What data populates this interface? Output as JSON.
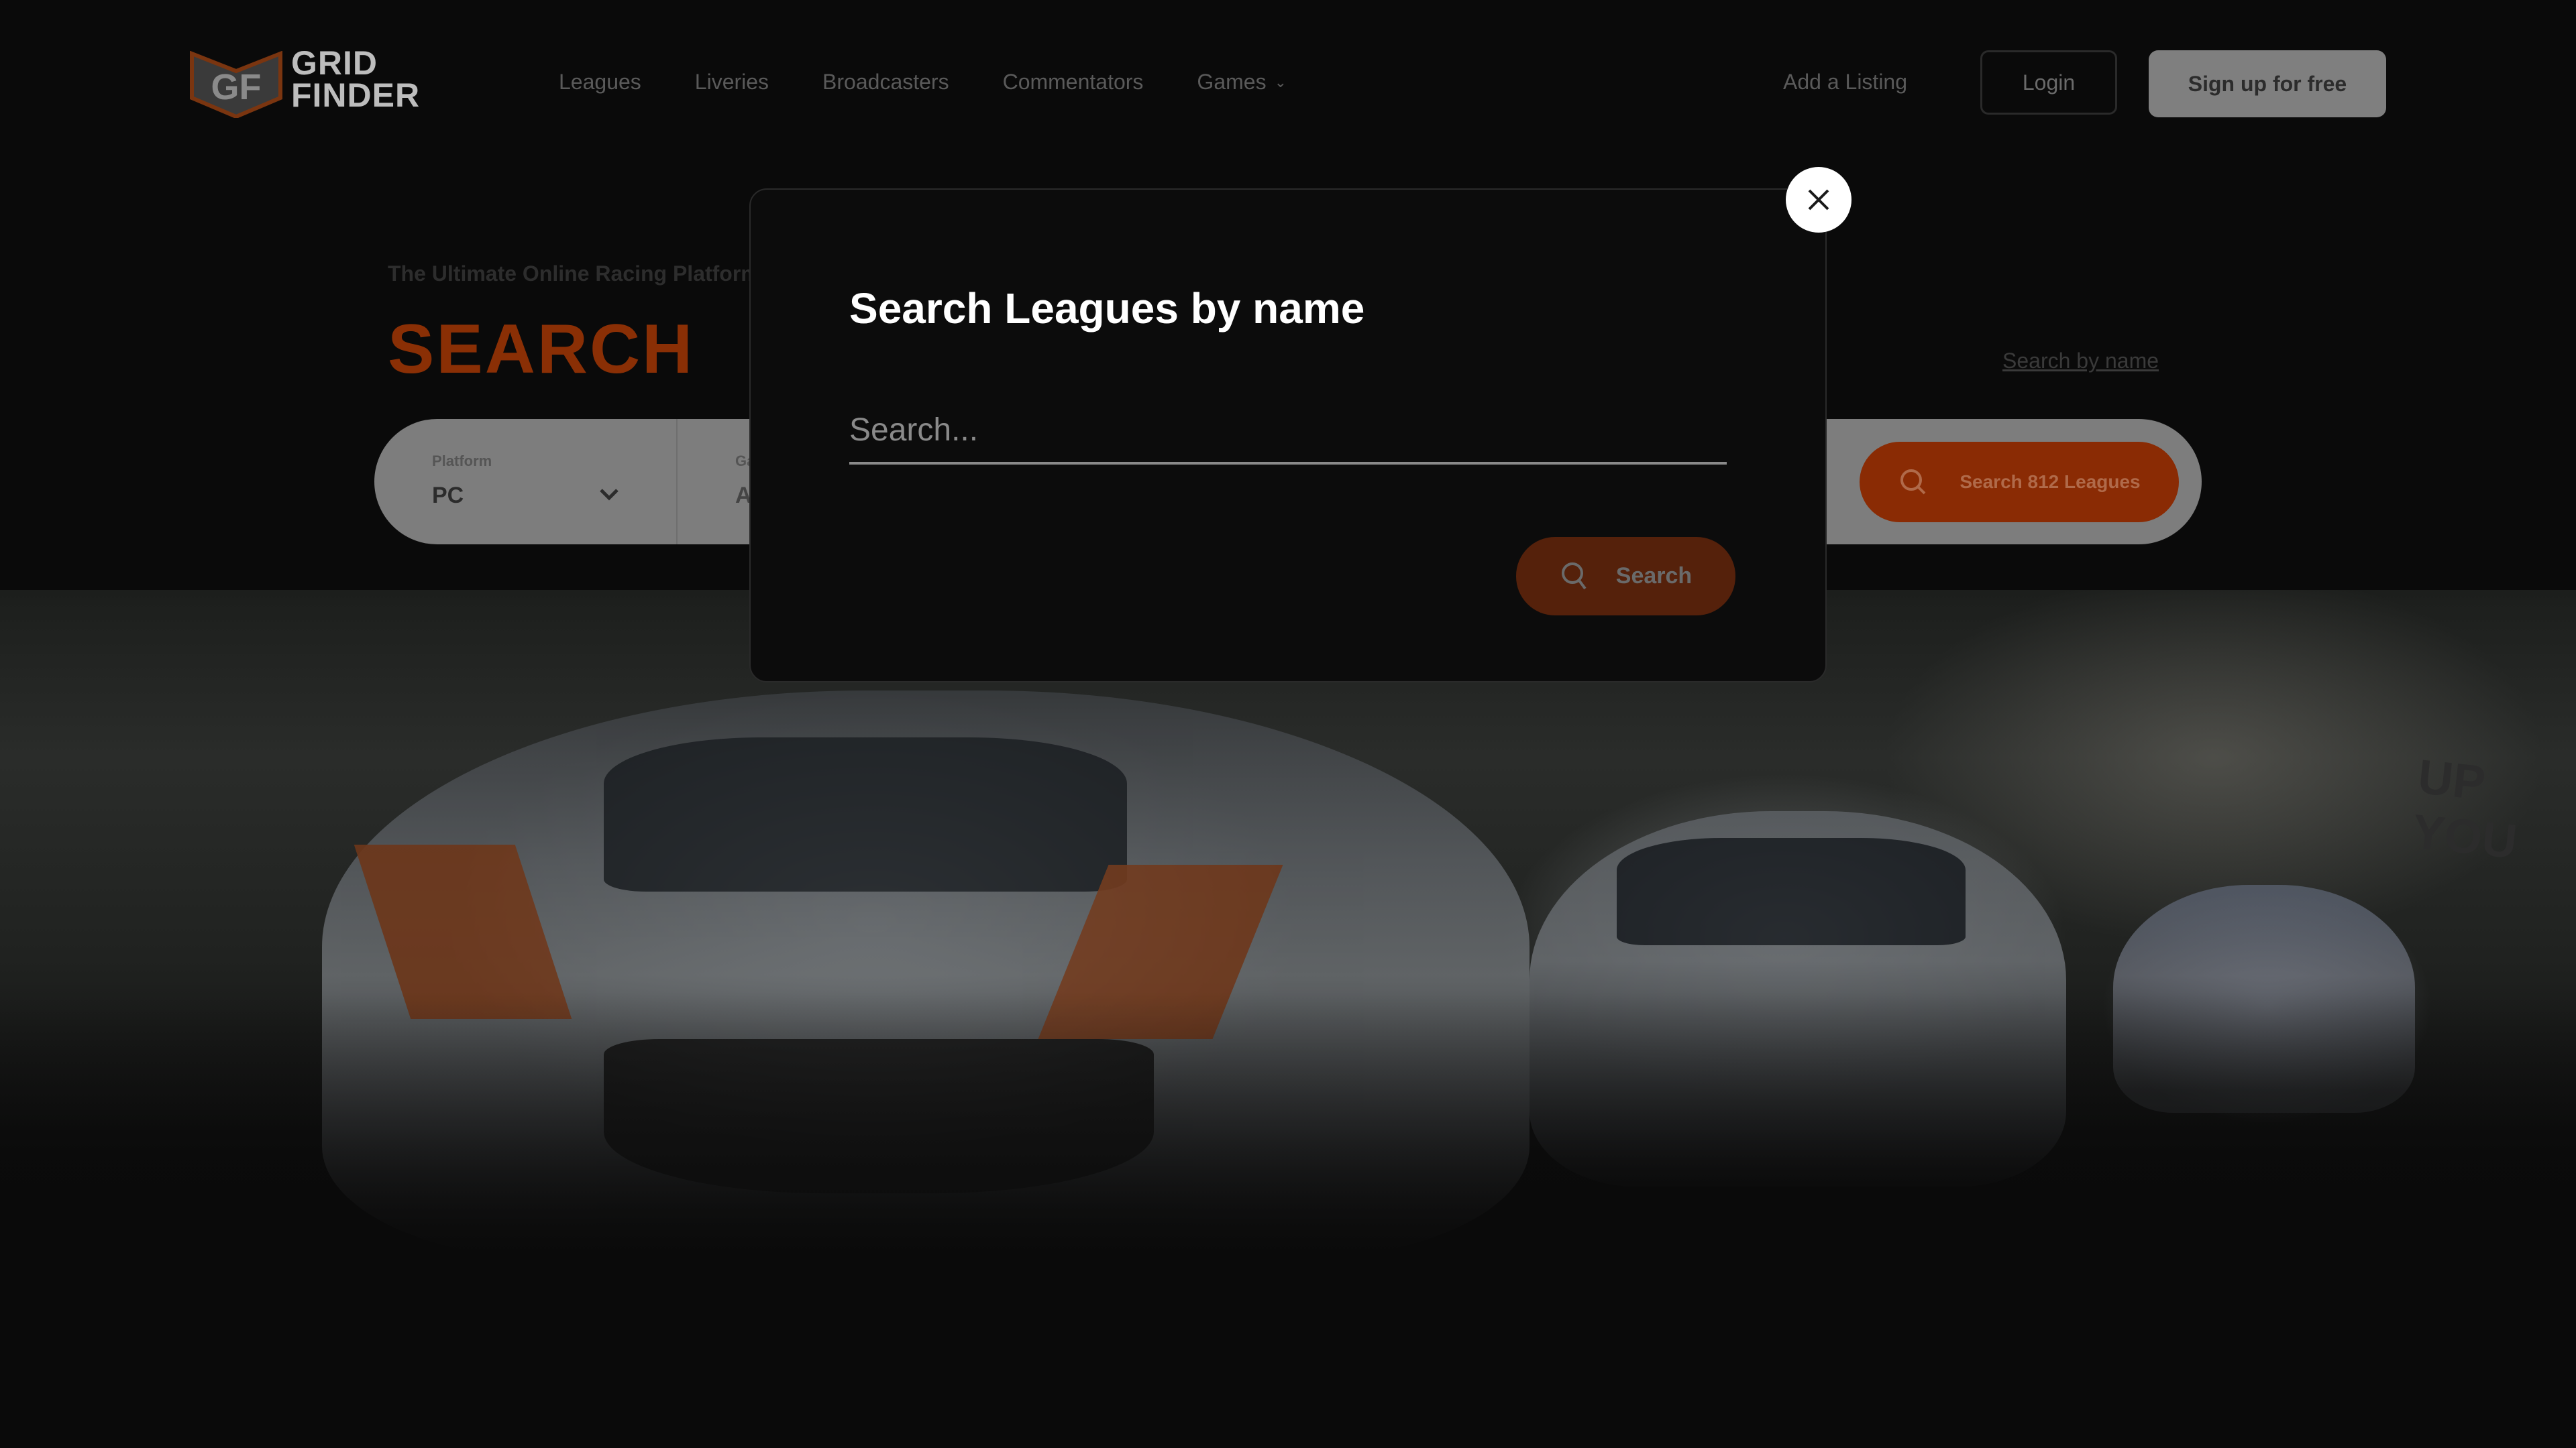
{
  "header": {
    "logo": {
      "line1": "GRID",
      "line2": "FINDER",
      "mark": "GF"
    },
    "nav": [
      {
        "label": "Leagues"
      },
      {
        "label": "Liveries"
      },
      {
        "label": "Broadcasters"
      },
      {
        "label": "Commentators"
      },
      {
        "label": "Games",
        "has_dropdown": true,
        "icon": "chevron-down-icon"
      }
    ],
    "add_listing": "Add a Listing",
    "login": "Login",
    "signup": "Sign up for free"
  },
  "hero": {
    "tagline": "The Ultimate Online Racing Platform",
    "headline": "SEARCH",
    "search_by_name_link": "Search by name",
    "search_bar": {
      "platform": {
        "label": "Platform",
        "value": "PC"
      },
      "game": {
        "label": "Game",
        "value": "Any"
      },
      "submit": {
        "label": "Search 812 Leagues",
        "icon": "search-icon"
      }
    },
    "background_text": "UP YOU"
  },
  "modal": {
    "title": "Search Leagues by name",
    "input": {
      "value": "",
      "placeholder": "Search..."
    },
    "search_button": {
      "label": "Search",
      "icon": "search-icon"
    },
    "close_icon": "close-icon"
  },
  "colors": {
    "brand_orange": "#e8560c",
    "modal_bg": "#0c0c0c",
    "page_bg": "#0a0a0a"
  }
}
